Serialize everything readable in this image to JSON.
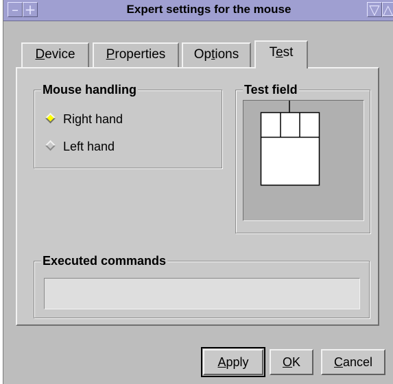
{
  "window": {
    "title": "Expert settings for the mouse"
  },
  "titlebar": {
    "left_icon": "minimize-icon",
    "left_icon2": "move-icon",
    "right_icon": "shade-icon",
    "right_icon2": "maximize-icon"
  },
  "tabs": [
    {
      "first": "D",
      "rest": "evice"
    },
    {
      "first": "P",
      "rest": "roperties"
    },
    {
      "pre": "Op",
      "u": "t",
      "post": "ions"
    },
    {
      "pre": "T",
      "u": "e",
      "post": "st"
    }
  ],
  "mouse_handling": {
    "title": "Mouse handling",
    "right_hand": "Right hand",
    "left_hand": "Left hand",
    "selected": "Right hand"
  },
  "test_field": {
    "title": "Test field"
  },
  "executed_commands": {
    "title": "Executed commands",
    "value": ""
  },
  "buttons": {
    "apply": {
      "first": "A",
      "rest": "pply"
    },
    "ok": {
      "first": "O",
      "rest": "K"
    },
    "cancel": {
      "first": "C",
      "rest": "ancel"
    }
  }
}
